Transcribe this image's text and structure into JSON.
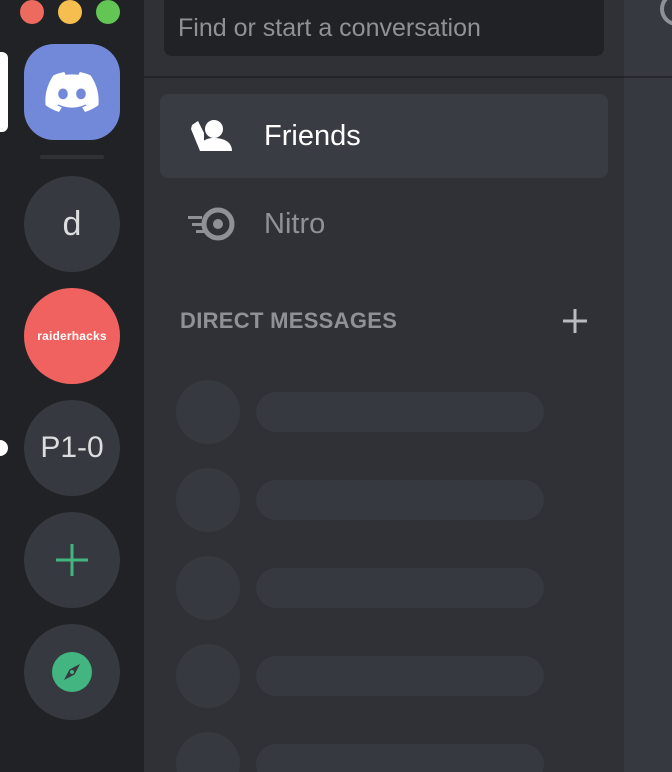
{
  "window": {
    "controls": [
      "close",
      "minimize",
      "zoom"
    ]
  },
  "servers": [
    {
      "name": "home",
      "icon": "discord-logo-icon",
      "color": "#7289da"
    },
    {
      "name": "d",
      "label": "d",
      "color": "#36393f"
    },
    {
      "name": "raiderhacks",
      "label": "raiderhacks",
      "color": "#f0625f"
    },
    {
      "name": "p1-0",
      "label": "P1-0",
      "color": "#36393f",
      "unread": true
    },
    {
      "name": "add-server",
      "icon": "plus-icon",
      "accent": "#43b581"
    },
    {
      "name": "explore",
      "icon": "compass-icon",
      "accent": "#43b581"
    }
  ],
  "search": {
    "placeholder": "Find or start a conversation"
  },
  "nav": {
    "friends_label": "Friends",
    "nitro_label": "Nitro"
  },
  "direct_messages": {
    "title": "DIRECT MESSAGES",
    "add_icon": "plus-icon"
  },
  "colors": {
    "blurple": "#7289da",
    "green": "#43b581",
    "raider": "#f0625f",
    "rail": "#202225",
    "sidebar": "#2f3136",
    "main": "#36393f"
  }
}
